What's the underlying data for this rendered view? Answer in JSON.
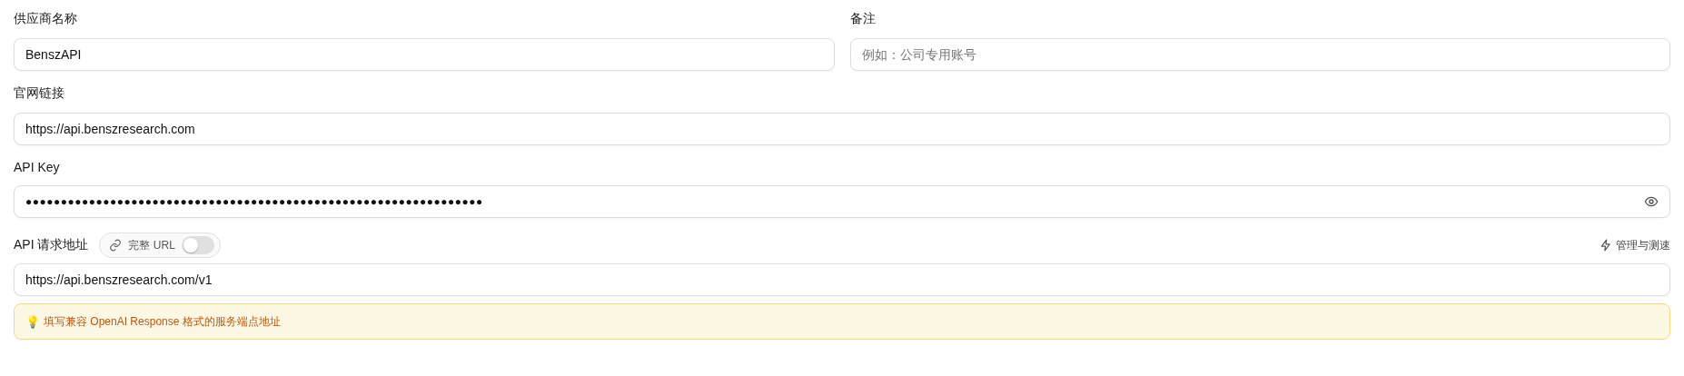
{
  "provider_name": {
    "label": "供应商名称",
    "value": "BenszAPI"
  },
  "note": {
    "label": "备注",
    "placeholder": "例如：公司专用账号"
  },
  "website": {
    "label": "官网链接",
    "value": "https://api.benszresearch.com"
  },
  "api_key": {
    "label": "API Key",
    "value": "●●●●●●●●●●●●●●●●●●●●●●●●●●●●●●●●●●●●●●●●●●●●●●●●●●●●●●●●●●●●●●●●●"
  },
  "api_url": {
    "label": "API 请求地址",
    "toggle": {
      "label": "完整 URL",
      "on": false
    },
    "action": "管理与测速",
    "value": "https://api.benszresearch.com/v1",
    "hint": {
      "icon": "💡",
      "text": "填写兼容 OpenAI Response 格式的服务端点地址"
    }
  }
}
